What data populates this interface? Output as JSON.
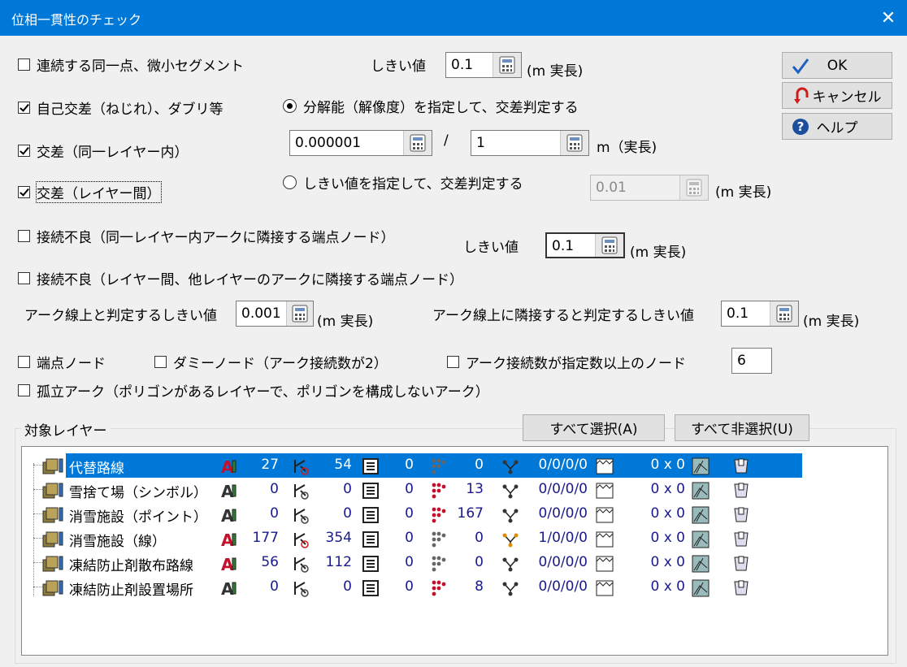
{
  "window": {
    "title": "位相一貫性のチェック",
    "close": "✕"
  },
  "checks": {
    "c1": {
      "label": "連続する同一点、微小セグメント",
      "checked": false
    },
    "c2": {
      "label": "自己交差（ねじれ）、ダブリ等",
      "checked": true
    },
    "c3": {
      "label": "交差（同一レイヤー内）",
      "checked": true
    },
    "c4": {
      "label": "交差（レイヤー間）",
      "checked": true
    },
    "c5": {
      "label": "接続不良（同一レイヤー内アークに隣接する端点ノード）",
      "checked": false
    },
    "c6": {
      "label": "接続不良（レイヤー間、他レイヤーのアークに隣接する端点ノード）",
      "checked": false
    },
    "c7": {
      "label": "端点ノード",
      "checked": false
    },
    "c8": {
      "label": "ダミーノード（アーク接続数が2）",
      "checked": false
    },
    "c9": {
      "label": "アーク接続数が指定数以上のノード",
      "checked": false
    },
    "c10": {
      "label": "孤立アーク（ポリゴンがあるレイヤーで、ポリゴンを構成しないアーク）",
      "checked": false
    }
  },
  "radios": {
    "r1": {
      "label": "分解能（解像度）を指定して、交差判定する",
      "on": true
    },
    "r2": {
      "label": "しきい値を指定して、交差判定する",
      "on": false
    }
  },
  "labels": {
    "thr1": "しきい値",
    "unit1": "(m  実長)",
    "slash": "/",
    "unit2": "m（実長)",
    "unit3": "(m  実長)",
    "thr2": "しきい値",
    "unit4": "(m  実長)",
    "arcThr": "アーク線上と判定するしきい値",
    "unit5": "(m  実長)",
    "arcAdjThr": "アーク線上に隣接すると判定するしきい値",
    "unit6": "(m  実長)",
    "group": "対象レイヤー"
  },
  "inputs": {
    "i1": "0.1",
    "i2": "0.000001",
    "i3": "1",
    "i4": "0.01",
    "i5": "0.1",
    "i6": "0.001",
    "i7": "0.1",
    "i8": "6"
  },
  "buttons": {
    "ok": "OK",
    "cancel": "キャンセル",
    "help": "ヘルプ",
    "selectAll": "すべて選択(A)",
    "deselectAll": "すべて非選択(U)"
  },
  "layers": [
    {
      "name": "代替路線",
      "n1": "27",
      "n2": "54",
      "n3": "0",
      "n4": "0",
      "n5": "0/0/0/0",
      "n6": "0 x 0",
      "selected": true
    },
    {
      "name": "雪捨て場（シンボル）",
      "n1": "0",
      "n2": "0",
      "n3": "0",
      "n4": "13",
      "n5": "0/0/0/0",
      "n6": "0 x 0",
      "selected": false
    },
    {
      "name": "消雪施設（ポイント）",
      "n1": "0",
      "n2": "0",
      "n3": "0",
      "n4": "167",
      "n5": "0/0/0/0",
      "n6": "0 x 0",
      "selected": false
    },
    {
      "name": "消雪施設（線）",
      "n1": "177",
      "n2": "354",
      "n3": "0",
      "n4": "0",
      "n5": "1/0/0/0",
      "n6": "0 x 0",
      "selected": false
    },
    {
      "name": "凍結防止剤散布路線",
      "n1": "56",
      "n2": "112",
      "n3": "0",
      "n4": "0",
      "n5": "0/0/0/0",
      "n6": "0 x 0",
      "selected": false
    },
    {
      "name": "凍結防止剤設置場所",
      "n1": "0",
      "n2": "0",
      "n3": "0",
      "n4": "8",
      "n5": "0/0/0/0",
      "n6": "0 x 0",
      "selected": false
    }
  ],
  "colors": {
    "titlebar": "#0078d7",
    "selection": "#0078d7",
    "number": "#1a1a8c",
    "okCheck": "#1f5fbf",
    "cancelIcon": "#d11a1a",
    "helpIcon": "#1b4f9c"
  }
}
